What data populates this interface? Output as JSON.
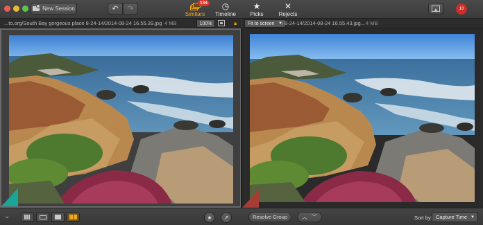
{
  "toolbar": {
    "new_session_label": "New Session",
    "undo_icon": "↶",
    "redo_icon": "↷",
    "tabs": [
      {
        "label": "Similars",
        "badge": "134",
        "active": true
      },
      {
        "label": "Timeline"
      },
      {
        "label": "Picks"
      },
      {
        "label": "Rejects"
      }
    ],
    "record_label": "10"
  },
  "left_info": {
    "path": "...to.org/South Bay gorgeous place 8-24-14/2014-08-24 16.55.39.jpg",
    "size": "4 MB",
    "zoom": "100%"
  },
  "right_info": {
    "fit_option": "Fit to screen",
    "path": "...to.org/South Bay gorgeous place 8-24-14/2014-08-24 16.55.43.jpg",
    "size": "4 MB"
  },
  "bottombar": {
    "resolve_label": "Resolve Group",
    "sort_by_label": "Sort by:",
    "sort_value": "Capture Time"
  },
  "colors": {
    "accent": "#f0a623",
    "badge": "#d8352a",
    "teal_marker": "#1aa59a",
    "red_marker": "#a83b36"
  }
}
